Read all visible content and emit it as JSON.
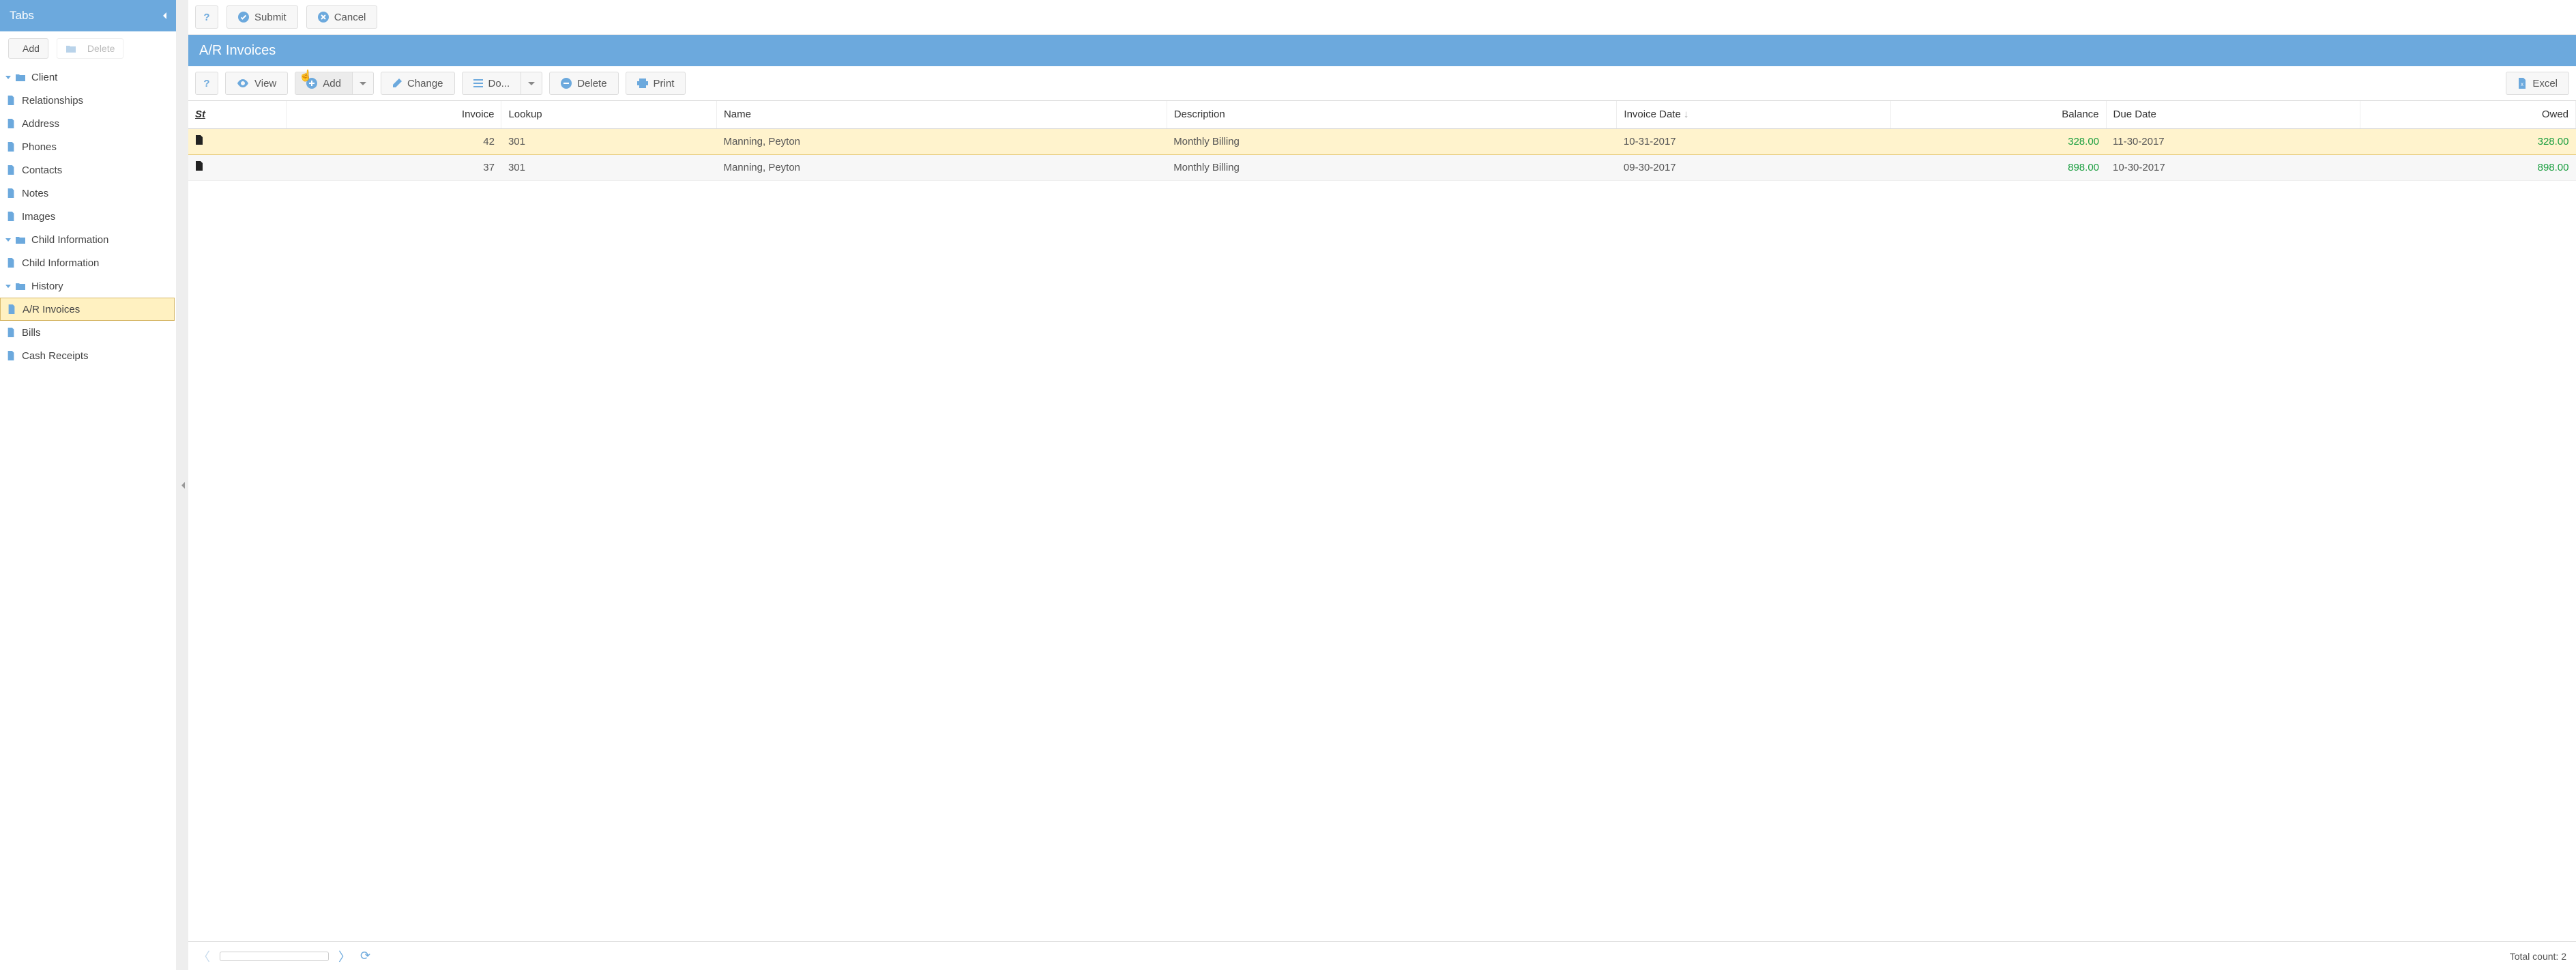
{
  "sidebar": {
    "title": "Tabs",
    "add_label": "Add",
    "delete_label": "Delete",
    "tree": {
      "client": "Client",
      "relationships": "Relationships",
      "address": "Address",
      "phones": "Phones",
      "contacts": "Contacts",
      "notes": "Notes",
      "images": "Images",
      "child_info_folder": "Child Information",
      "child_info_item": "Child Information",
      "history": "History",
      "ar_invoices": "A/R Invoices",
      "bills": "Bills",
      "cash_receipts": "Cash Receipts"
    }
  },
  "toolbar_top": {
    "submit": "Submit",
    "cancel": "Cancel"
  },
  "page_title": "A/R Invoices",
  "toolbar2": {
    "view": "View",
    "add": "Add",
    "change": "Change",
    "do": "Do...",
    "delete": "Delete",
    "print": "Print",
    "excel": "Excel"
  },
  "grid": {
    "columns": {
      "st": "St",
      "invoice": "Invoice",
      "lookup": "Lookup",
      "name": "Name",
      "description": "Description",
      "invoice_date": "Invoice Date",
      "balance": "Balance",
      "due_date": "Due Date",
      "owed": "Owed"
    },
    "rows": [
      {
        "invoice": "42",
        "lookup": "301",
        "name": "Manning, Peyton",
        "description": "Monthly Billing",
        "invoice_date": "10-31-2017",
        "balance": "328.00",
        "due_date": "11-30-2017",
        "owed": "328.00"
      },
      {
        "invoice": "37",
        "lookup": "301",
        "name": "Manning, Peyton",
        "description": "Monthly Billing",
        "invoice_date": "09-30-2017",
        "balance": "898.00",
        "due_date": "10-30-2017",
        "owed": "898.00"
      }
    ]
  },
  "footer": {
    "total_count": "Total count: 2"
  }
}
